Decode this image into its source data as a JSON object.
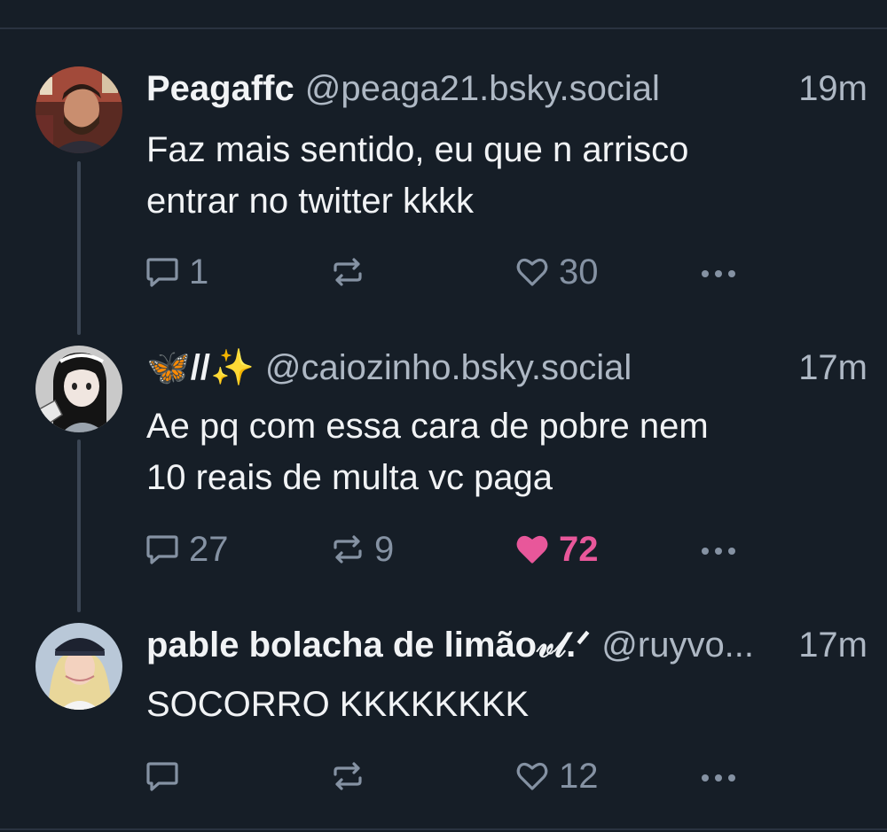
{
  "posts": [
    {
      "display_name": "Peagaffc",
      "handle": "@peaga21.bsky.social",
      "time": "19m",
      "text_lines": [
        "Faz mais sentido, eu que n arrisco",
        "entrar no twitter kkkk"
      ],
      "replies": "1",
      "reposts": "",
      "likes": "30",
      "liked": false,
      "avatar_icon": "avatar-photo-man"
    },
    {
      "display_name": "🦋//✨",
      "handle": "@caiozinho.bsky.social",
      "time": "17m",
      "text_lines": [
        "Ae pq com essa cara de pobre nem",
        "10 reais de multa vc paga"
      ],
      "replies": "27",
      "reposts": "9",
      "likes": "72",
      "liked": true,
      "avatar_icon": "avatar-anime-girl"
    },
    {
      "display_name": "pable bolacha de limão𝓋𝓁.ᐟ",
      "handle": "@ruyvo...",
      "time": "17m",
      "text_lines": [
        "SOCORRO KKKKKKKK"
      ],
      "replies": "",
      "reposts": "",
      "likes": "12",
      "liked": false,
      "avatar_icon": "avatar-blonde-cap"
    }
  ],
  "colors": {
    "background": "#161e27",
    "muted": "#8592a3",
    "like_active": "#e8579a",
    "thread_line": "#3b4654"
  },
  "icons": {
    "reply": "speech-bubble-icon",
    "repost": "repost-arrows-icon",
    "like": "heart-icon",
    "more": "ellipsis-icon"
  }
}
